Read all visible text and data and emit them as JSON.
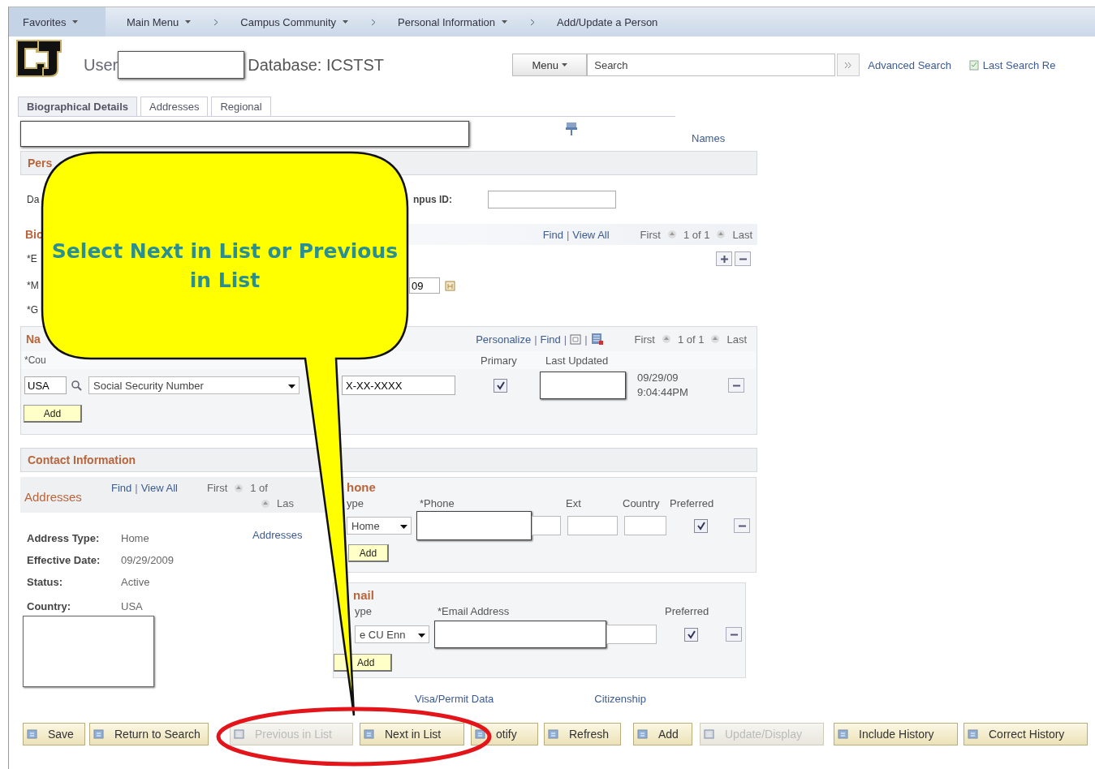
{
  "nav": {
    "menus": [
      {
        "label": "Favorites"
      },
      {
        "label": "Main Menu"
      }
    ],
    "breadcrumb": [
      {
        "label": "Campus Community",
        "has_menu": true
      },
      {
        "label": "Personal Information",
        "has_menu": true
      },
      {
        "label": "Add/Update a Person",
        "has_menu": false
      }
    ]
  },
  "header": {
    "user_label": "User",
    "database": "Database: ICSTST",
    "menu_button": "Menu",
    "search_placeholder": "Search",
    "advanced_search": "Advanced Search",
    "last_search": "Last Search Re"
  },
  "tabs": [
    {
      "label": "Biographical Details",
      "selected": true
    },
    {
      "label": "Addresses",
      "selected": false
    },
    {
      "label": "Regional",
      "selected": false
    }
  ],
  "names_link": "Names",
  "person_section": "Pers",
  "person_row": {
    "label": "Da",
    "campus_label": "npus ID:"
  },
  "bio": {
    "title": "Bio",
    "find": "Find",
    "divider": "|",
    "view_all": "View All",
    "first": "First",
    "count": "1 of 1",
    "last": "Last",
    "labels": [
      "*E",
      "*M",
      "*G"
    ],
    "date_fragment": "09"
  },
  "names_grid": {
    "title": "Na",
    "personalize": "Personalize",
    "divider": "|",
    "find": "Find",
    "first": "First",
    "count": "1 of 1",
    "last": "Last",
    "columns": [
      "*Cou",
      "Primary",
      "Last Updated"
    ],
    "row": {
      "country": "USA",
      "id_type": "Social Security Number",
      "id": "X-XX-XXXX",
      "primary": true,
      "date": "09/29/09",
      "time": "9:04:44PM"
    },
    "add": "Add"
  },
  "contact_title": "Contact Information",
  "addresses": {
    "title": "Addresses",
    "find": "Find",
    "divider": "|",
    "view_all": "View All",
    "first": "First",
    "count": "1 of",
    "last": "Las",
    "fields": [
      {
        "label": "Address Type:",
        "value": "Home"
      },
      {
        "label": "Effective Date:",
        "value": "09/29/2009"
      },
      {
        "label": "Status:",
        "value": "Active"
      },
      {
        "label": "Country:",
        "value": "USA"
      }
    ],
    "link": "Addresses"
  },
  "phone": {
    "title": "hone",
    "columns": [
      "ype",
      "*Phone",
      "Ext",
      "Country",
      "Preferred"
    ],
    "type": "Home",
    "preferred": true,
    "add": "Add"
  },
  "email": {
    "title": "nail",
    "columns": [
      "ype",
      "*Email Address",
      "Preferred"
    ],
    "type": "e CU Enn",
    "preferred": true,
    "add": "Add"
  },
  "links": [
    "Visa/Permit Data",
    "Citizenship"
  ],
  "toolbar": [
    {
      "label": "Save",
      "disabled": false
    },
    {
      "label": "Return to Search",
      "disabled": false
    },
    {
      "label": "Previous in List",
      "disabled": true
    },
    {
      "label": "Next in List",
      "disabled": false
    },
    {
      "label": "otify",
      "disabled": false
    },
    {
      "label": "Refresh",
      "disabled": false
    },
    {
      "label": "Add",
      "disabled": false
    },
    {
      "label": "Update/Display",
      "disabled": true
    },
    {
      "label": "Include History",
      "disabled": false
    },
    {
      "label": "Correct History",
      "disabled": false
    }
  ],
  "callout": {
    "text": "Select Next in List or Previous in List"
  }
}
